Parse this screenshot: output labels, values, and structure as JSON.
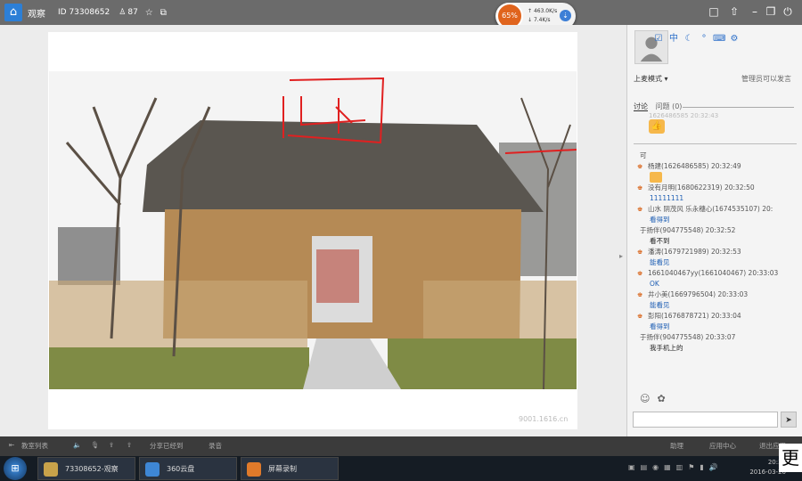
{
  "window": {
    "title": "观察",
    "id_label": "ID 73308652",
    "count": "87"
  },
  "speed": {
    "percent": "65%",
    "up": "463.0K/s",
    "down": "7.4K/s"
  },
  "panel": {
    "mode_label": "上麦模式 ▾",
    "manager_note": "管理员可以发言",
    "tab_discuss": "讨论",
    "tab_questions": "问题",
    "tab_questions_count": "(0)",
    "prev_line": "1626486585 20:32:43",
    "input_placeholder": ""
  },
  "messages": [
    {
      "type": "s",
      "text": "可"
    },
    {
      "type": "h",
      "text": "杨建(1626486585) 20:32:49"
    },
    {
      "type": "wave"
    },
    {
      "type": "h",
      "text": "没有月明(1680622319) 20:32:50"
    },
    {
      "type": "b",
      "text": "11111111"
    },
    {
      "type": "h",
      "text": "山水 阴茂风 乐永穗心(1674535107) 20:"
    },
    {
      "type": "b",
      "text": "看得到"
    },
    {
      "type": "s",
      "text": "于扬伴(904775548) 20:32:52"
    },
    {
      "type": "bd",
      "text": "看不到"
    },
    {
      "type": "h",
      "text": "潘涛(1679721989) 20:32:53"
    },
    {
      "type": "b",
      "text": "能看见"
    },
    {
      "type": "h",
      "text": "1661040467yy(1661040467) 20:33:03"
    },
    {
      "type": "b",
      "text": "OK"
    },
    {
      "type": "h",
      "text": "井小美(1669796504) 20:33:03"
    },
    {
      "type": "b",
      "text": "能看见"
    },
    {
      "type": "h",
      "text": "彭阳(1676878721) 20:33:04"
    },
    {
      "type": "b",
      "text": "看得到"
    },
    {
      "type": "s",
      "text": "于扬伴(904775548) 20:33:07"
    },
    {
      "type": "bd",
      "text": "我手机上的"
    }
  ],
  "toolbar": {
    "list": "教室列表",
    "share": "分享已经到",
    "record": "录音",
    "help": "助理",
    "app_center": "应用中心",
    "exit": "退出应用"
  },
  "taskbar": {
    "tasks": [
      "73308652-观察",
      "360云盘",
      "屏幕录制"
    ],
    "time": "20:35",
    "date": "2016-03-20"
  },
  "watermark": "9001.1616.cn",
  "corner_char": "更",
  "colors": {
    "accent": "#2c7fd6",
    "speed_ring": "#e0641d",
    "drawing": "#e02020"
  }
}
